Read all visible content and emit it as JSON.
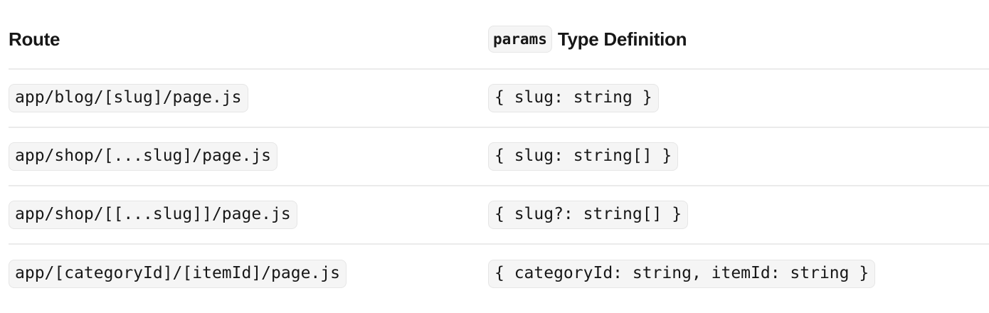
{
  "header": {
    "route": "Route",
    "params_code": "params",
    "type_definition": "Type Definition"
  },
  "rows": [
    {
      "route": "app/blog/[slug]/page.js",
      "params": "{ slug: string }"
    },
    {
      "route": "app/shop/[...slug]/page.js",
      "params": "{ slug: string[] }"
    },
    {
      "route": "app/shop/[[...slug]]/page.js",
      "params": "{ slug?: string[] }"
    },
    {
      "route": "app/[categoryId]/[itemId]/page.js",
      "params": "{ categoryId: string, itemId: string }"
    }
  ]
}
